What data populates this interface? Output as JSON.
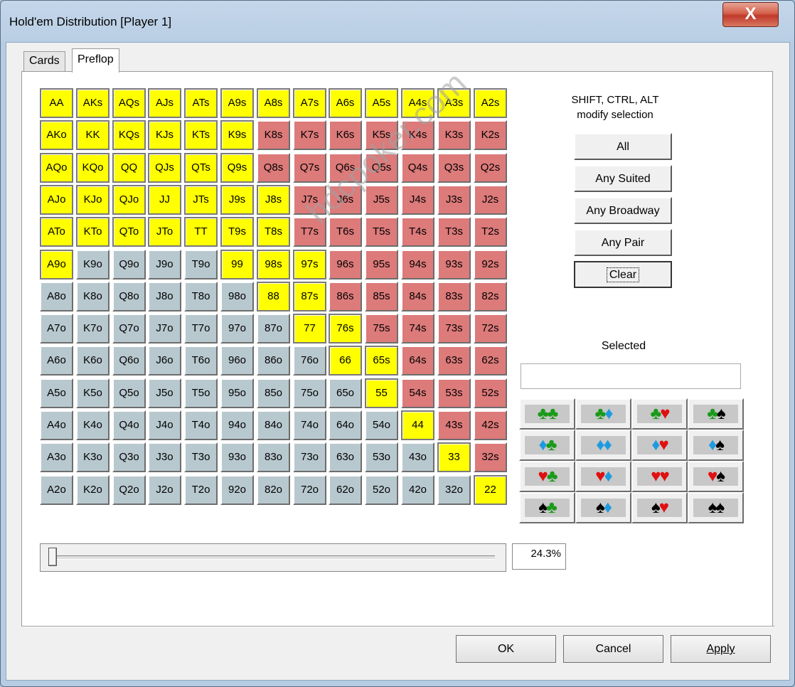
{
  "window": {
    "title": "Hold'em Distribution [Player 1]",
    "close_label": "X"
  },
  "tabs": [
    {
      "label": "Cards",
      "active": false
    },
    {
      "label": "Preflop",
      "active": true
    }
  ],
  "grid": {
    "colors": {
      "selected": "#ffff00",
      "suited": "#dd7a7a",
      "offsuit": "#b8c8cf"
    },
    "rows": [
      [
        [
          "AA",
          1
        ],
        [
          "AKs",
          1
        ],
        [
          "AQs",
          1
        ],
        [
          "AJs",
          1
        ],
        [
          "ATs",
          1
        ],
        [
          "A9s",
          1
        ],
        [
          "A8s",
          1
        ],
        [
          "A7s",
          1
        ],
        [
          "A6s",
          1
        ],
        [
          "A5s",
          1
        ],
        [
          "A4s",
          1
        ],
        [
          "A3s",
          1
        ],
        [
          "A2s",
          1
        ]
      ],
      [
        [
          "AKo",
          1
        ],
        [
          "KK",
          1
        ],
        [
          "KQs",
          1
        ],
        [
          "KJs",
          1
        ],
        [
          "KTs",
          1
        ],
        [
          "K9s",
          1
        ],
        [
          "K8s",
          0
        ],
        [
          "K7s",
          0
        ],
        [
          "K6s",
          0
        ],
        [
          "K5s",
          0
        ],
        [
          "K4s",
          0
        ],
        [
          "K3s",
          0
        ],
        [
          "K2s",
          0
        ]
      ],
      [
        [
          "AQo",
          1
        ],
        [
          "KQo",
          1
        ],
        [
          "QQ",
          1
        ],
        [
          "QJs",
          1
        ],
        [
          "QTs",
          1
        ],
        [
          "Q9s",
          1
        ],
        [
          "Q8s",
          0
        ],
        [
          "Q7s",
          0
        ],
        [
          "Q6s",
          0
        ],
        [
          "Q5s",
          0
        ],
        [
          "Q4s",
          0
        ],
        [
          "Q3s",
          0
        ],
        [
          "Q2s",
          0
        ]
      ],
      [
        [
          "AJo",
          1
        ],
        [
          "KJo",
          1
        ],
        [
          "QJo",
          1
        ],
        [
          "JJ",
          1
        ],
        [
          "JTs",
          1
        ],
        [
          "J9s",
          1
        ],
        [
          "J8s",
          1
        ],
        [
          "J7s",
          0
        ],
        [
          "J6s",
          0
        ],
        [
          "J5s",
          0
        ],
        [
          "J4s",
          0
        ],
        [
          "J3s",
          0
        ],
        [
          "J2s",
          0
        ]
      ],
      [
        [
          "ATo",
          1
        ],
        [
          "KTo",
          1
        ],
        [
          "QTo",
          1
        ],
        [
          "JTo",
          1
        ],
        [
          "TT",
          1
        ],
        [
          "T9s",
          1
        ],
        [
          "T8s",
          1
        ],
        [
          "T7s",
          0
        ],
        [
          "T6s",
          0
        ],
        [
          "T5s",
          0
        ],
        [
          "T4s",
          0
        ],
        [
          "T3s",
          0
        ],
        [
          "T2s",
          0
        ]
      ],
      [
        [
          "A9o",
          1
        ],
        [
          "K9o",
          0
        ],
        [
          "Q9o",
          0
        ],
        [
          "J9o",
          0
        ],
        [
          "T9o",
          0
        ],
        [
          "99",
          1
        ],
        [
          "98s",
          1
        ],
        [
          "97s",
          1
        ],
        [
          "96s",
          0
        ],
        [
          "95s",
          0
        ],
        [
          "94s",
          0
        ],
        [
          "93s",
          0
        ],
        [
          "92s",
          0
        ]
      ],
      [
        [
          "A8o",
          0
        ],
        [
          "K8o",
          0
        ],
        [
          "Q8o",
          0
        ],
        [
          "J8o",
          0
        ],
        [
          "T8o",
          0
        ],
        [
          "98o",
          0
        ],
        [
          "88",
          1
        ],
        [
          "87s",
          1
        ],
        [
          "86s",
          0
        ],
        [
          "85s",
          0
        ],
        [
          "84s",
          0
        ],
        [
          "83s",
          0
        ],
        [
          "82s",
          0
        ]
      ],
      [
        [
          "A7o",
          0
        ],
        [
          "K7o",
          0
        ],
        [
          "Q7o",
          0
        ],
        [
          "J7o",
          0
        ],
        [
          "T7o",
          0
        ],
        [
          "97o",
          0
        ],
        [
          "87o",
          0
        ],
        [
          "77",
          1
        ],
        [
          "76s",
          1
        ],
        [
          "75s",
          0
        ],
        [
          "74s",
          0
        ],
        [
          "73s",
          0
        ],
        [
          "72s",
          0
        ]
      ],
      [
        [
          "A6o",
          0
        ],
        [
          "K6o",
          0
        ],
        [
          "Q6o",
          0
        ],
        [
          "J6o",
          0
        ],
        [
          "T6o",
          0
        ],
        [
          "96o",
          0
        ],
        [
          "86o",
          0
        ],
        [
          "76o",
          0
        ],
        [
          "66",
          1
        ],
        [
          "65s",
          1
        ],
        [
          "64s",
          0
        ],
        [
          "63s",
          0
        ],
        [
          "62s",
          0
        ]
      ],
      [
        [
          "A5o",
          0
        ],
        [
          "K5o",
          0
        ],
        [
          "Q5o",
          0
        ],
        [
          "J5o",
          0
        ],
        [
          "T5o",
          0
        ],
        [
          "95o",
          0
        ],
        [
          "85o",
          0
        ],
        [
          "75o",
          0
        ],
        [
          "65o",
          0
        ],
        [
          "55",
          1
        ],
        [
          "54s",
          0
        ],
        [
          "53s",
          0
        ],
        [
          "52s",
          0
        ]
      ],
      [
        [
          "A4o",
          0
        ],
        [
          "K4o",
          0
        ],
        [
          "Q4o",
          0
        ],
        [
          "J4o",
          0
        ],
        [
          "T4o",
          0
        ],
        [
          "94o",
          0
        ],
        [
          "84o",
          0
        ],
        [
          "74o",
          0
        ],
        [
          "64o",
          0
        ],
        [
          "54o",
          0
        ],
        [
          "44",
          1
        ],
        [
          "43s",
          0
        ],
        [
          "42s",
          0
        ]
      ],
      [
        [
          "A3o",
          0
        ],
        [
          "K3o",
          0
        ],
        [
          "Q3o",
          0
        ],
        [
          "J3o",
          0
        ],
        [
          "T3o",
          0
        ],
        [
          "93o",
          0
        ],
        [
          "83o",
          0
        ],
        [
          "73o",
          0
        ],
        [
          "63o",
          0
        ],
        [
          "53o",
          0
        ],
        [
          "43o",
          0
        ],
        [
          "33",
          1
        ],
        [
          "32s",
          0
        ]
      ],
      [
        [
          "A2o",
          0
        ],
        [
          "K2o",
          0
        ],
        [
          "Q2o",
          0
        ],
        [
          "J2o",
          0
        ],
        [
          "T2o",
          0
        ],
        [
          "92o",
          0
        ],
        [
          "82o",
          0
        ],
        [
          "72o",
          0
        ],
        [
          "62o",
          0
        ],
        [
          "52o",
          0
        ],
        [
          "42o",
          0
        ],
        [
          "32o",
          0
        ],
        [
          "22",
          1
        ]
      ]
    ]
  },
  "modifiers": {
    "hint_line1": "SHIFT, CTRL, ALT",
    "hint_line2": "modify selection",
    "buttons": [
      "All",
      "Any Suited",
      "Any Broadway",
      "Any Pair",
      "Clear"
    ]
  },
  "selected": {
    "label": "Selected",
    "value": ""
  },
  "suits": {
    "symbols": {
      "c": "♣",
      "d": "♦",
      "h": "♥",
      "s": "♠"
    },
    "colors": {
      "c": "#1a9a1a",
      "d": "#1e9be0",
      "h": "#e01010",
      "s": "#000000"
    },
    "order": [
      "c",
      "d",
      "h",
      "s"
    ]
  },
  "slider": {
    "percent_text": "24.3%",
    "level": 0.0
  },
  "dialog_buttons": {
    "ok": "OK",
    "cancel": "Cancel",
    "apply": "Apply"
  },
  "watermark": "hdcpoker.com"
}
